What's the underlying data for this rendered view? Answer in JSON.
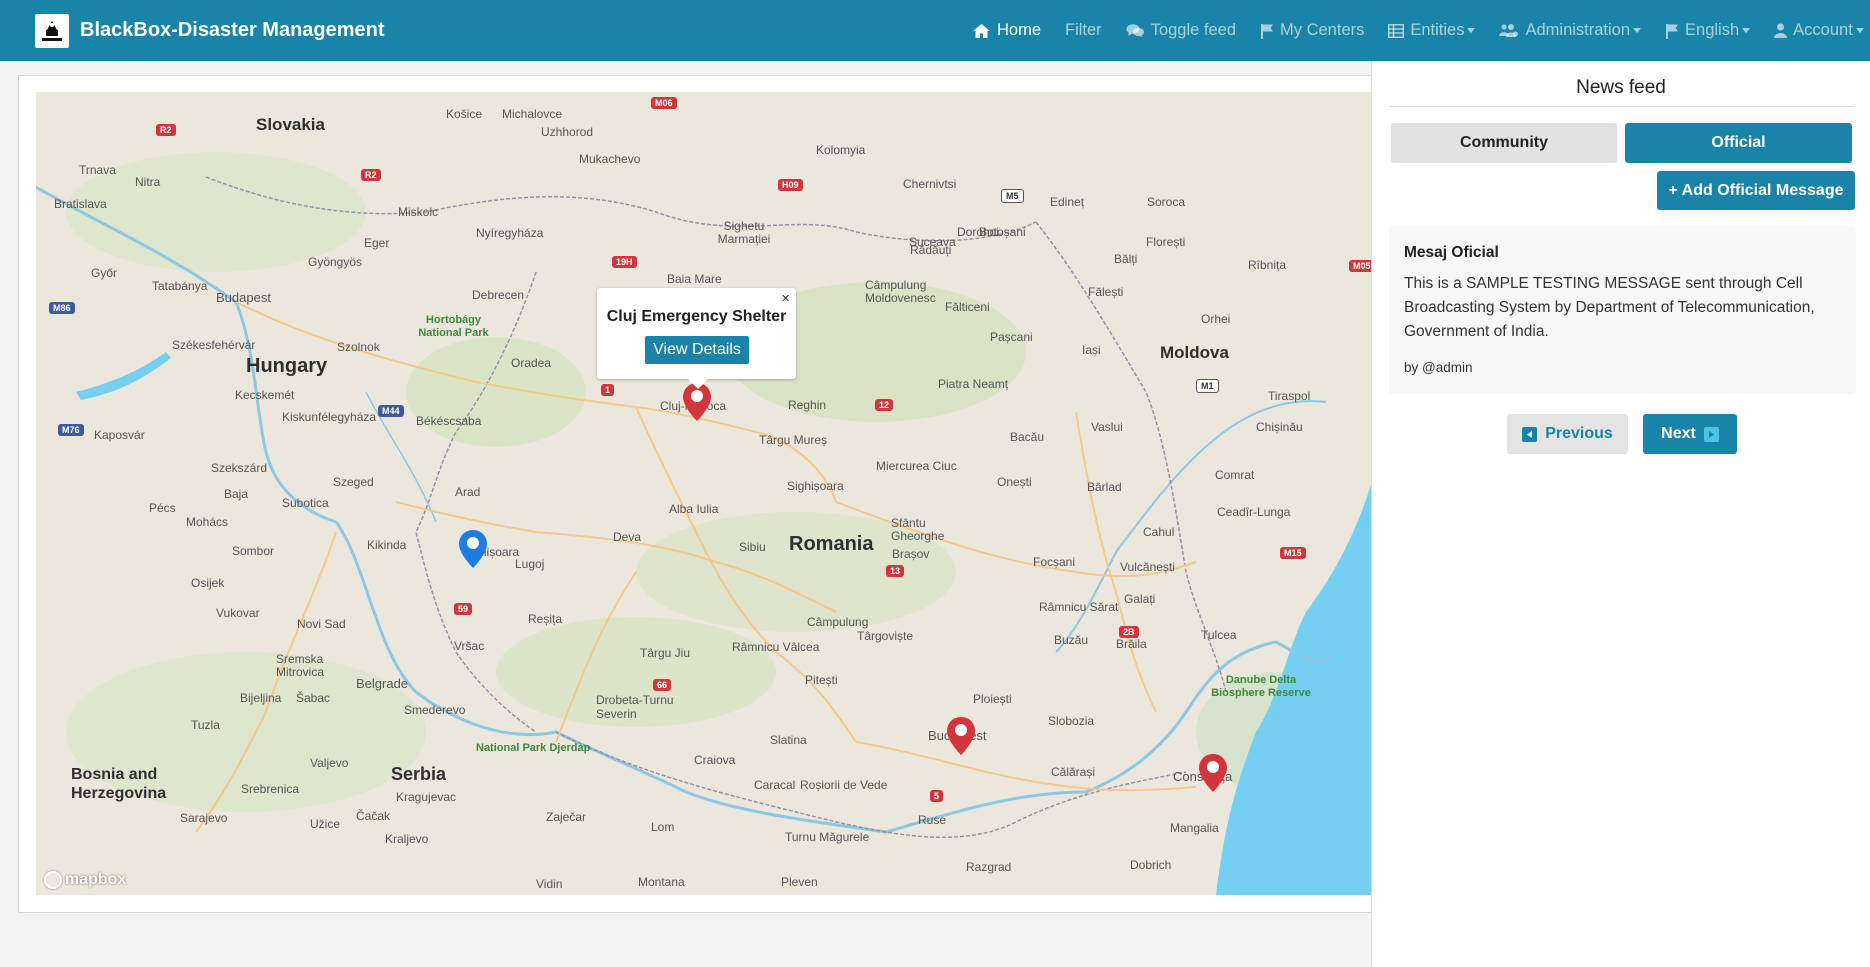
{
  "brand": {
    "title": "BlackBox-Disaster Management",
    "logo_text": "BLACKBOX"
  },
  "nav": {
    "home": "Home",
    "filter": "Filter",
    "toggle_feed": "Toggle feed",
    "my_centers": "My Centers",
    "entities": "Entities",
    "administration": "Administration",
    "language": "English",
    "account": "Account"
  },
  "map": {
    "popup": {
      "title": "Cluj Emergency Shelter",
      "button": "View Details",
      "close": "×"
    },
    "attribution": "mapbox",
    "countries": [
      "Slovakia",
      "Hungary",
      "Romania",
      "Moldova",
      "Serbia",
      "Bosnia and Herzegovina"
    ],
    "cities": [
      "Košice",
      "Michalovce",
      "Uzhhorod",
      "Mukachevo",
      "Kolomyia",
      "Chernivtsi",
      "Bratislava",
      "Trnava",
      "Nitra",
      "Miskolc",
      "Eger",
      "Gyöngyös",
      "Nyíregyháza",
      "Budapest",
      "Debrecen",
      "Székesfehérvár",
      "Szolnok",
      "Tatabánya",
      "Győr",
      "Oradea",
      "Cluj-Napoca",
      "Reghin",
      "Baia Mare",
      "Sighetu Marmației",
      "Suceava",
      "Botoșani",
      "Iași",
      "Bacău",
      "Piatra Neamț",
      "Vaslui",
      "Chișinău",
      "Tiraspol",
      "Bălți",
      "Orhei",
      "Târgu Mureș",
      "Miercurea Ciuc",
      "Sighișoara",
      "Arad",
      "Szeged",
      "Kecskemét",
      "Békéscsaba",
      "Kiskunfélegyháza",
      "Timișoara",
      "Lugoj",
      "Deva",
      "Alba Iulia",
      "Sibiu",
      "Brașov",
      "Sfântu Gheorghe",
      "Focșani",
      "Galați",
      "Tulcea",
      "Brăila",
      "Buzău",
      "Râmnicu Sărat",
      "Ploiești",
      "Târgoviște",
      "Pitești",
      "Râmnicu Vâlcea",
      "Câmpulung",
      "Târgu Jiu",
      "Craiova",
      "Slatina",
      "Drobeta-Turnu Severin",
      "Reșița",
      "Vršac",
      "Novi Sad",
      "Belgrade",
      "Smederevo",
      "Kragujevac",
      "Valjevo",
      "Sarajevo",
      "Tuzla",
      "Bucharest",
      "Constanța",
      "Mangalia",
      "Ruse",
      "Pleven",
      "Montana",
      "Lom",
      "Vidin",
      "Razgrad",
      "Dobrich",
      "Slobozia",
      "Călărași",
      "Caracal",
      "Roșiorii de Vede",
      "Turnu Măgurele",
      "Zaječar",
      "Kraljevo",
      "Čačak",
      "Užice",
      "Srebrenica",
      "Bijeljina",
      "Šabac",
      "Sremska Mitrovica",
      "Subotica",
      "Sombor",
      "Osijek",
      "Vukovar",
      "Pécs",
      "Mohács",
      "Baja",
      "Kaposvár",
      "Szekszárd",
      "Kikinda",
      "Comrat",
      "Cahul",
      "Ceadîr-Lunga",
      "Vulcănești",
      "Edineț",
      "Soroca",
      "Florești",
      "Rîbnița",
      "Dorohoi",
      "Câmpulung Moldovenesc",
      "Rădăuți",
      "Fălticeni",
      "Pașcani",
      "Fălești",
      "Onești",
      "Bârlad"
    ],
    "parks": [
      "Hortobágy National Park",
      "National Park Djerdap",
      "Danube Delta Biosphere Reserve"
    ],
    "markers": [
      {
        "name": "Cluj Emergency Shelter",
        "color": "#d1363f"
      },
      {
        "name": "Timișoara",
        "color": "#1e7be0"
      },
      {
        "name": "Bucharest",
        "color": "#d1363f"
      },
      {
        "name": "Constanța",
        "color": "#d1363f"
      }
    ]
  },
  "feed": {
    "title": "News feed",
    "tabs": {
      "community": "Community",
      "official": "Official"
    },
    "add_button": "+ Add Official Message",
    "message": {
      "title": "Mesaj Oficial",
      "body": "This is a SAMPLE TESTING MESSAGE sent through Cell Broadcasting System by Department of Telecommunication, Government of India.",
      "author": "by @admin"
    },
    "prev": "Previous",
    "next": "Next"
  },
  "colors": {
    "primary": "#1a84a8",
    "marker_red": "#d1363f",
    "marker_blue": "#1e7be0",
    "water": "#75cff0"
  }
}
